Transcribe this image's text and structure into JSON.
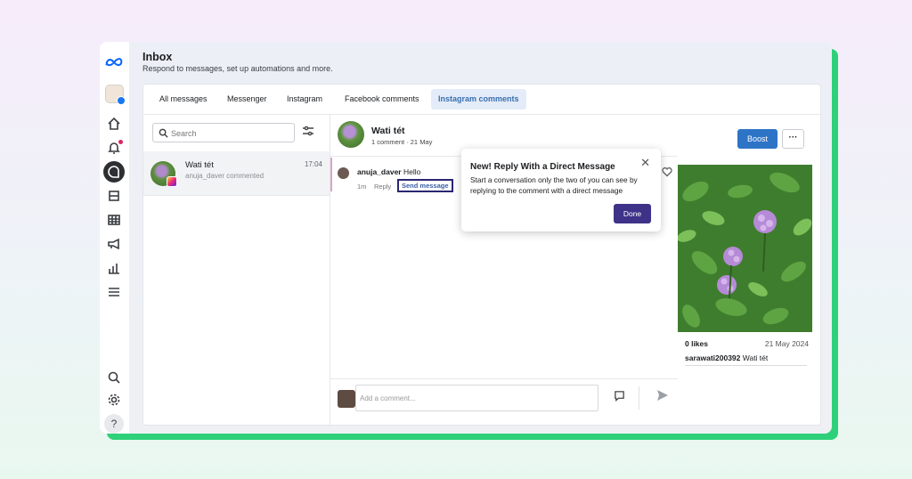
{
  "app": {
    "title": "Inbox",
    "subtitle": "Respond to messages, set up automations and more."
  },
  "rail": {
    "icons": [
      "meta-logo-icon",
      "profile-avatar",
      "home-icon",
      "notifications-icon",
      "inbox-icon",
      "pages-icon",
      "table-icon",
      "megaphone-icon",
      "insights-icon",
      "menu-icon",
      "search-icon",
      "settings-icon",
      "help-icon"
    ],
    "help_label": "?"
  },
  "tabs": [
    {
      "label": "All messages",
      "active": false
    },
    {
      "label": "Messenger",
      "active": false
    },
    {
      "label": "Instagram",
      "active": false
    },
    {
      "label": "Facebook comments",
      "active": false
    },
    {
      "label": "Instagram comments",
      "active": true
    }
  ],
  "search": {
    "placeholder": "Search"
  },
  "conversations": [
    {
      "name": "Wati tét",
      "preview": "anuja_daver commented",
      "time": "17:04"
    }
  ],
  "thread": {
    "name": "Wati tét",
    "meta": "1 comment · 21 May",
    "comment": {
      "author": "anuja_daver",
      "text": "Hello",
      "time": "1m",
      "reply_label": "Reply",
      "send_label": "Send message"
    },
    "composer_placeholder": "Add a comment..."
  },
  "post": {
    "boost_label": "Boost",
    "more_label": "···",
    "likes": "0 likes",
    "date": "21 May 2024",
    "caption_author": "sarawati200392",
    "caption_text": "Wati tét"
  },
  "popup": {
    "title": "New! Reply With a Direct Message",
    "body": "Start a conversation only the two of you can see by replying to the comment with a direct message",
    "close_label": "✕",
    "done_label": "Done"
  },
  "colors": {
    "accent": "#2e74c6",
    "done_button": "#3d3288",
    "frame_green": "#2fd07a",
    "active_tab_bg": "#e3ecf8"
  }
}
